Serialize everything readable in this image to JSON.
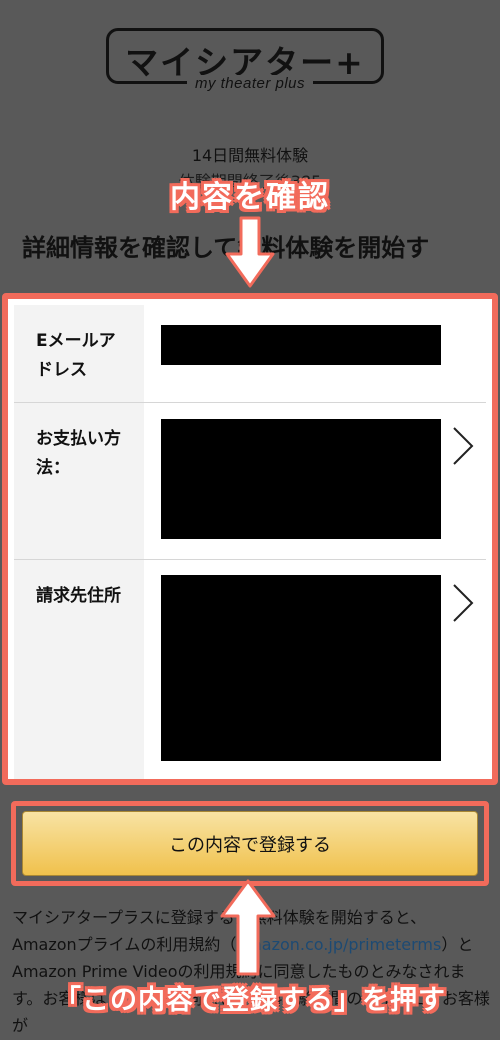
{
  "header": {
    "logo_text": "マイシアター+",
    "logo_sub": "my theater plus"
  },
  "trial": {
    "title": "14日間無料体験",
    "subtitle": "体験期間終了後385"
  },
  "heading": "詳細情報を確認して無料体験を開始す",
  "annotations": {
    "top": "内容を確認",
    "bottom": "「この内容で登録する」を押す",
    "color": "#f26b5b"
  },
  "details": {
    "email_label": "Eメールアドレス",
    "payment_label": "お支払い方法：",
    "billing_label": "請求先住所"
  },
  "button": {
    "label": "この内容で登録する"
  },
  "terms": {
    "line1": "マイシアタープラスに登録するか無料体験を開始すると、Amazonプライムの利用規約",
    "link": "amazon.co.jp/primeterms",
    "line2": "とAmazon Prime Videoの利用規約に同意したものとみなされます。お客様はこの内容に同意し、無料体験期間の終了後に、お客様が"
  },
  "colors": {
    "background": "#595959",
    "button_top": "#f8e3a4",
    "button_bottom": "#f0c14c",
    "link": "#1d4a73"
  }
}
